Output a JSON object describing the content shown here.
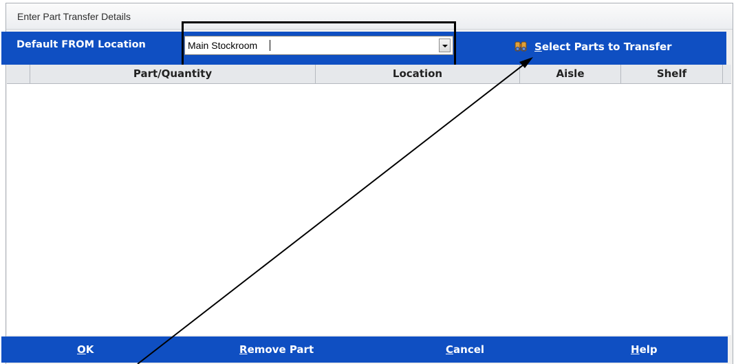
{
  "dialog": {
    "title": "Enter Part Transfer Details"
  },
  "from_location": {
    "label": "Default FROM Location",
    "value": "Main Stockroom"
  },
  "select_parts": {
    "mnemonic": "S",
    "rest": "elect Parts to Transfer",
    "icon": "binoculars-icon"
  },
  "grid": {
    "columns": [
      "Part/Quantity",
      "Location",
      "Aisle",
      "Shelf"
    ],
    "rows": []
  },
  "buttons": {
    "ok": {
      "mnemonic": "O",
      "rest": "K"
    },
    "remove_part": {
      "mnemonic": "R",
      "rest": "emove Part"
    },
    "cancel": {
      "mnemonic": "C",
      "rest": "ancel"
    },
    "help": {
      "mnemonic": "H",
      "rest": "elp"
    }
  },
  "colors": {
    "band_blue": "#0f4fc2",
    "header_gray": "#e6e8eb",
    "annotation": "#000000"
  }
}
